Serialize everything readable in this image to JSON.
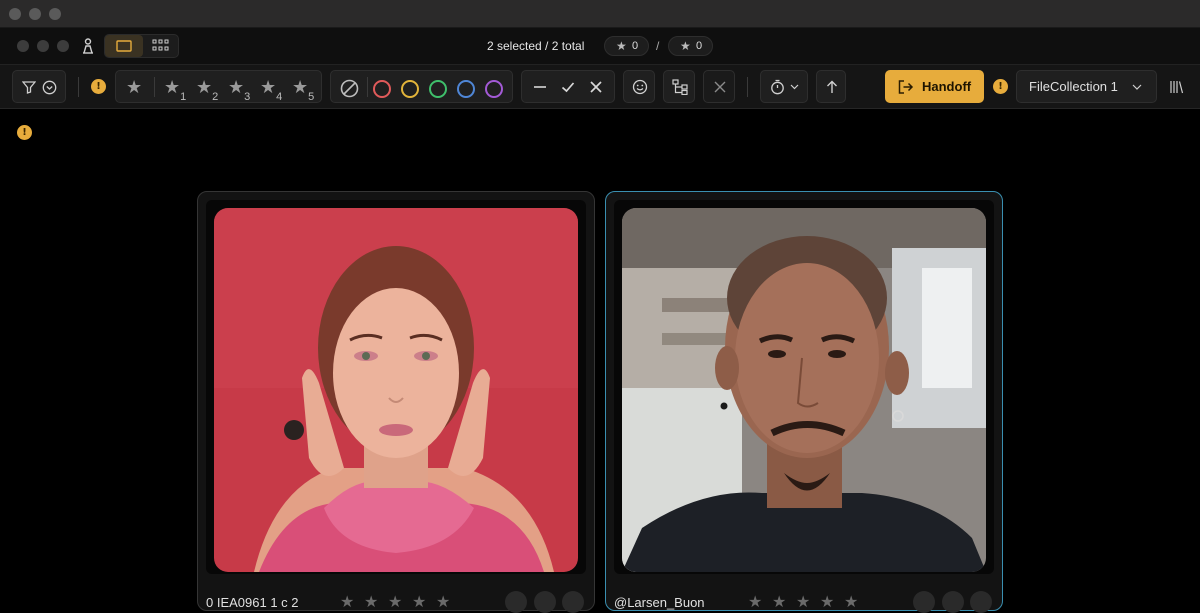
{
  "header": {
    "selection_text": "2 selected / 2 total",
    "left_star_count": "0",
    "separator": "/",
    "right_star_count": "0"
  },
  "toolbar": {
    "warning_glyph": "!",
    "rating_suffixes": [
      "1",
      "2",
      "3",
      "4",
      "5"
    ],
    "color_labels": [
      {
        "name": "red",
        "color": "#e05a5a"
      },
      {
        "name": "yellow",
        "color": "#e2b43a"
      },
      {
        "name": "green",
        "color": "#3fbf6b"
      },
      {
        "name": "blue",
        "color": "#4f86d6"
      },
      {
        "name": "purple",
        "color": "#a35ad6"
      }
    ],
    "handoff_label": "Handoff",
    "collection_select": "FileCollection 1"
  },
  "colors": {
    "accent": "#e7ac3c",
    "selected_border": "#3a8fb0"
  },
  "cards": [
    {
      "filename": "0 IEA0961 1 c 2"
    },
    {
      "filename": "@Larsen_Buon"
    }
  ]
}
